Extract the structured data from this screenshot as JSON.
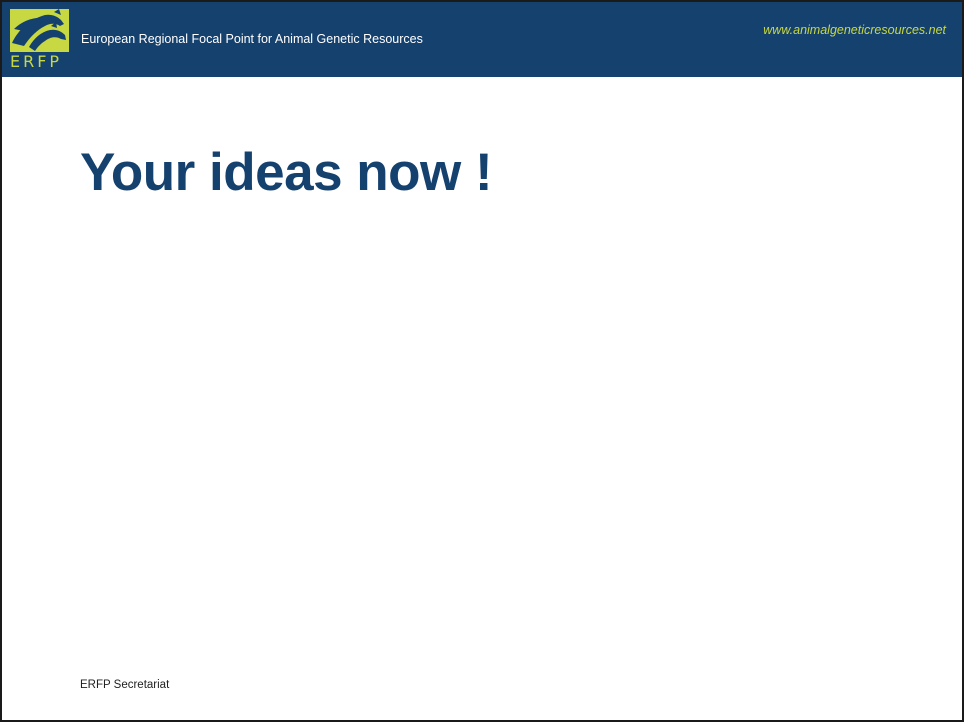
{
  "header": {
    "logo_text": "ERFP",
    "org_name": "European Regional Focal Point for Animal Genetic Resources",
    "website": "www.animalgeneticresources.net"
  },
  "slide": {
    "title": "Your ideas now !"
  },
  "footer": {
    "text": "ERFP Secretariat"
  },
  "colors": {
    "header_background": "#15416f",
    "accent": "#c8d842",
    "title": "#15416f",
    "background": "#ffffff"
  },
  "icons": {
    "logo": "animal-heads-logo"
  }
}
